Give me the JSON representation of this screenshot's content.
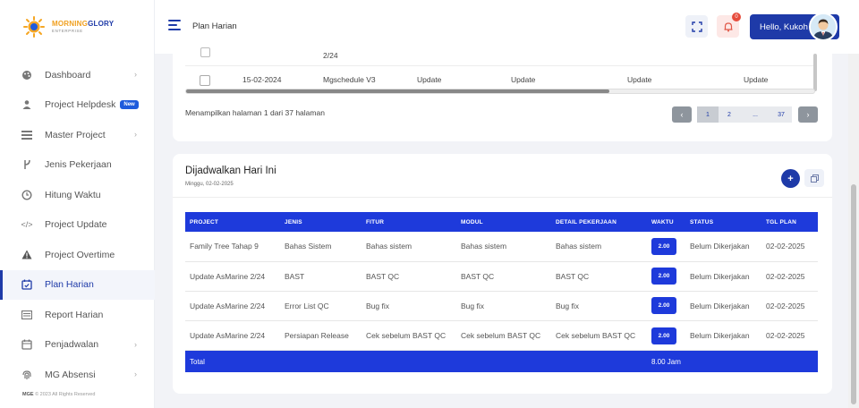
{
  "brand": {
    "name_part1": "MORNING",
    "name_part2": "GLORY",
    "tagline": "ENTERPRISE"
  },
  "sidebar": {
    "items": [
      {
        "label": "Dashboard",
        "icon": "palette-icon",
        "chevron": true
      },
      {
        "label": "Project Helpdesk",
        "icon": "user-headset-icon",
        "badge": "New"
      },
      {
        "label": "Master Project",
        "icon": "list-icon",
        "chevron": true
      },
      {
        "label": "Jenis Pekerjaan",
        "icon": "branch-icon"
      },
      {
        "label": "Hitung Waktu",
        "icon": "clock-icon"
      },
      {
        "label": "Project Update",
        "icon": "code-icon"
      },
      {
        "label": "Project Overtime",
        "icon": "warning-icon"
      },
      {
        "label": "Plan Harian",
        "icon": "calendar-check-icon",
        "active": true
      },
      {
        "label": "Report Harian",
        "icon": "report-icon"
      },
      {
        "label": "Penjadwalan",
        "icon": "calendar-icon",
        "chevron": true
      },
      {
        "label": "MG Absensi",
        "icon": "fingerprint-icon",
        "chevron": true
      }
    ],
    "copyright_brand": "MGE",
    "copyright_text": "© 2023 All Rights Reserved"
  },
  "header": {
    "title": "Plan Harian",
    "notif_count": "0",
    "greeting": "Hello, Kukoh"
  },
  "prev_table": {
    "partial_row_text": "2/24",
    "last_row": {
      "date": "15-02-2024",
      "project": "Mgschedule V3",
      "c1": "Update",
      "c2": "Update",
      "c3": "Update",
      "c4": "Update"
    },
    "info": "Menampilkan halaman 1 dari 37 halaman",
    "pages": [
      "1",
      "2",
      "...",
      "37"
    ],
    "prev_label": "‹",
    "next_label": "›"
  },
  "today": {
    "title": "Dijadwalkan Hari Ini",
    "subtitle": "Minggu, 02-02-2025",
    "add_label": "+",
    "columns": [
      "PROJECT",
      "JENIS",
      "FITUR",
      "MODUL",
      "DETAIL PEKERJAAN",
      "WAKTU",
      "STATUS",
      "TGL PLAN"
    ],
    "rows": [
      {
        "project": "Family Tree Tahap 9",
        "jenis": "Bahas Sistem",
        "fitur": "Bahas sistem",
        "modul": "Bahas sistem",
        "detail": "Bahas sistem",
        "waktu": "2.00",
        "status": "Belum Dikerjakan",
        "tgl": "02-02-2025"
      },
      {
        "project": "Update AsMarine 2/24",
        "jenis": "BAST",
        "fitur": "BAST QC",
        "modul": "BAST QC",
        "detail": "BAST QC",
        "waktu": "2.00",
        "status": "Belum Dikerjakan",
        "tgl": "02-02-2025"
      },
      {
        "project": "Update AsMarine 2/24",
        "jenis": "Error List QC",
        "fitur": "Bug fix",
        "modul": "Bug fix",
        "detail": "Bug fix",
        "waktu": "2.00",
        "status": "Belum Dikerjakan",
        "tgl": "02-02-2025"
      },
      {
        "project": "Update AsMarine 2/24",
        "jenis": "Persiapan Release",
        "fitur": "Cek sebelum BAST QC",
        "modul": "Cek sebelum BAST QC",
        "detail": "Cek sebelum BAST QC",
        "waktu": "2.00",
        "status": "Belum Dikerjakan",
        "tgl": "02-02-2025"
      }
    ],
    "total_label": "Total",
    "total_value": "8.00 Jam"
  },
  "colors": {
    "primary": "#1e3aa8",
    "table_header": "#1e3adb",
    "bell_bg": "#fde8e6"
  }
}
